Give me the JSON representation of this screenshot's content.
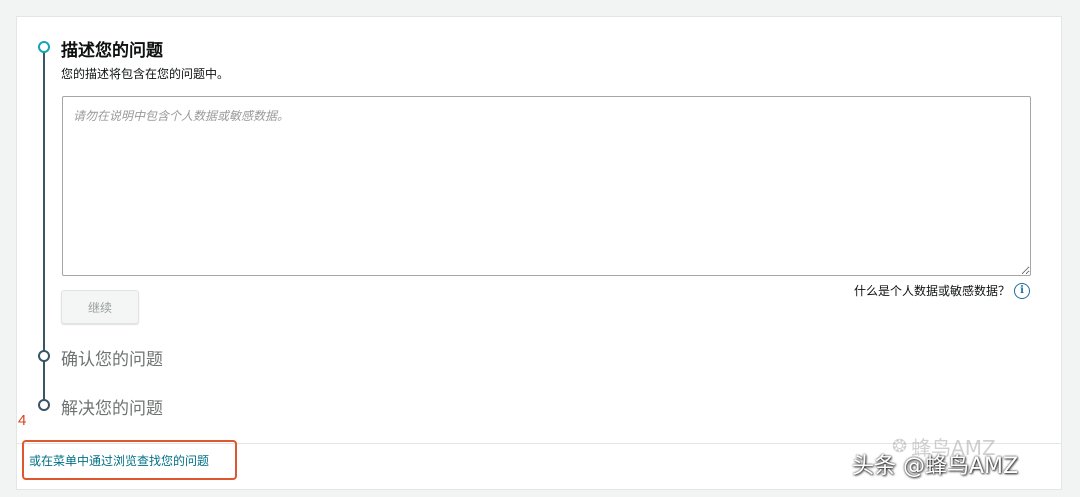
{
  "step1": {
    "title": "描述您的问题",
    "subtitle": "您的描述将包含在您的问题中。",
    "textarea_placeholder": "请勿在说明中包含个人数据或敏感数据。",
    "textarea_value": "",
    "privacy_link_text": "什么是个人数据或敏感数据？",
    "continue_label": "继续"
  },
  "step2": {
    "title": "确认您的问题"
  },
  "step3": {
    "title": "解决您的问题"
  },
  "browse_link": "或在菜单中通过浏览查找您的问题",
  "annotation_number": "4",
  "watermark": {
    "faint": "蜂鸟AMZ",
    "main": "头条 @蜂鸟AMZ"
  },
  "colors": {
    "accent_teal": "#16a2b8",
    "link": "#007185",
    "stepper_line": "#3a5566",
    "annotation_red": "#e0562e"
  },
  "icons": {
    "info": "info-icon",
    "wechat": "wechat-icon"
  }
}
